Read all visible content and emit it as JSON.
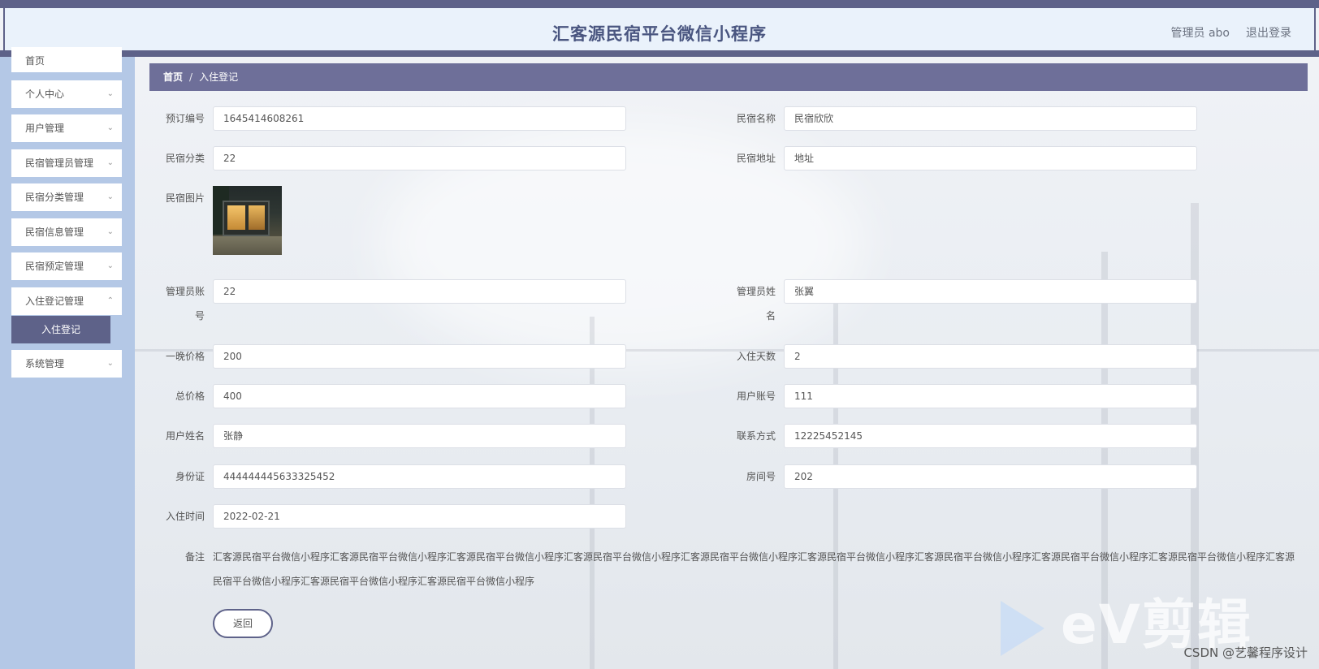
{
  "header": {
    "title": "汇客源民宿平台微信小程序",
    "user": "管理员 abo",
    "logout": "退出登录"
  },
  "sidebar": {
    "items": [
      {
        "label": "首页"
      },
      {
        "label": "个人中心"
      },
      {
        "label": "用户管理"
      },
      {
        "label": "民宿管理员管理"
      },
      {
        "label": "民宿分类管理"
      },
      {
        "label": "民宿信息管理"
      },
      {
        "label": "民宿预定管理"
      },
      {
        "label": "入住登记管理"
      },
      {
        "label": "系统管理"
      }
    ],
    "active_sub": "入住登记"
  },
  "breadcrumb": {
    "home": "首页",
    "separator": "/",
    "current": "入住登记"
  },
  "form": {
    "order_no": {
      "label": "预订编号",
      "value": "1645414608261"
    },
    "homestay_name": {
      "label": "民宿名称",
      "value": "民宿欣欣"
    },
    "category": {
      "label": "民宿分类",
      "value": "22"
    },
    "address": {
      "label": "民宿地址",
      "value": "地址"
    },
    "image": {
      "label": "民宿图片"
    },
    "admin_account": {
      "label_line1": "管理员账",
      "label_line2": "号",
      "value": "22"
    },
    "admin_name": {
      "label_line1": "管理员姓",
      "label_line2": "名",
      "value": "张翼"
    },
    "night_price": {
      "label": "一晚价格",
      "value": "200"
    },
    "days": {
      "label": "入住天数",
      "value": "2"
    },
    "total_price": {
      "label": "总价格",
      "value": "400"
    },
    "user_account": {
      "label": "用户账号",
      "value": "111"
    },
    "user_name": {
      "label": "用户姓名",
      "value": "张静"
    },
    "contact": {
      "label": "联系方式",
      "value": "12225452145"
    },
    "id_card": {
      "label": "身份证",
      "value": "444444445633325452"
    },
    "room_no": {
      "label": "房间号",
      "value": "202"
    },
    "checkin_time": {
      "label": "入住时间",
      "value": "2022-02-21"
    },
    "remark": {
      "label": "备注",
      "value": "汇客源民宿平台微信小程序汇客源民宿平台微信小程序汇客源民宿平台微信小程序汇客源民宿平台微信小程序汇客源民宿平台微信小程序汇客源民宿平台微信小程序汇客源民宿平台微信小程序汇客源民宿平台微信小程序汇客源民宿平台微信小程序汇客源民宿平台微信小程序汇客源民宿平台微信小程序汇客源民宿平台微信小程序"
    },
    "back_label": "返回"
  },
  "watermark": {
    "ev_text": "eV剪辑",
    "csdn_text": "CSDN @艺馨程序设计"
  }
}
